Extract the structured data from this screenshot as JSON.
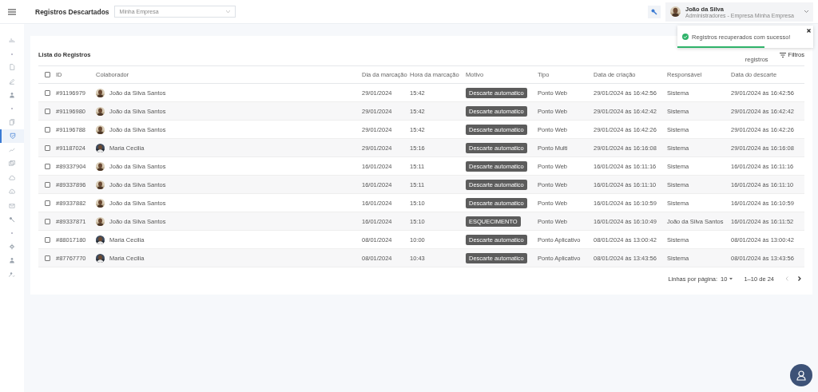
{
  "header": {
    "title": "Registros Descartados",
    "company_select": {
      "value": "Minha Empresa"
    },
    "user": {
      "name": "João da Silva",
      "role": "Administradores - Empresa Minha Empresa"
    }
  },
  "sidebar": {
    "items": [
      {
        "kind": "link",
        "selected": false
      },
      {
        "kind": "dot"
      },
      {
        "kind": "link",
        "selected": false
      },
      {
        "kind": "link",
        "selected": false
      },
      {
        "kind": "link",
        "selected": false
      },
      {
        "kind": "dot"
      },
      {
        "kind": "link",
        "selected": false
      },
      {
        "kind": "link",
        "selected": true
      },
      {
        "kind": "link",
        "selected": false
      },
      {
        "kind": "link",
        "selected": false
      },
      {
        "kind": "link",
        "selected": false
      },
      {
        "kind": "link",
        "selected": false
      },
      {
        "kind": "link",
        "selected": false
      },
      {
        "kind": "link",
        "selected": false
      },
      {
        "kind": "dot"
      },
      {
        "kind": "link",
        "selected": false
      },
      {
        "kind": "link",
        "selected": false
      },
      {
        "kind": "link",
        "selected": false
      }
    ]
  },
  "toast": {
    "message": "Registros recuperados com sucesso!",
    "level": 0.64
  },
  "card": {
    "title": "Lista do Registros",
    "recover_label": "registros",
    "filter_button": "Filtros"
  },
  "table": {
    "all_checked": false,
    "columns": [
      "ID",
      "Colaborador",
      "Dia da marcação",
      "Hora da marcação",
      "Motivo",
      "Tipo",
      "Data de criação",
      "Responsável",
      "Data do descarte"
    ],
    "rows": [
      {
        "checked": false,
        "id": "#91196979",
        "colaborador": "João da Silva Santos",
        "dia": "29/01/2024",
        "hora": "15:42",
        "motivo": "Descarte automatico",
        "tipo": "Ponto Web",
        "criacao": "29/01/2024 às 16:42:56",
        "responsavel": "Sistema",
        "descarte": "29/01/2024 às 16:42:56"
      },
      {
        "checked": false,
        "id": "#91196980",
        "colaborador": "João da Silva Santos",
        "dia": "29/01/2024",
        "hora": "15:42",
        "motivo": "Descarte automatico",
        "tipo": "Ponto Web",
        "criacao": "29/01/2024 às 16:42:42",
        "responsavel": "Sistema",
        "descarte": "29/01/2024 às 16:42:42"
      },
      {
        "checked": false,
        "id": "#91196788",
        "colaborador": "João da Silva Santos",
        "dia": "29/01/2024",
        "hora": "15:42",
        "motivo": "Descarte automatico",
        "tipo": "Ponto Web",
        "criacao": "29/01/2024 às 16:42:26",
        "responsavel": "Sistema",
        "descarte": "29/01/2024 às 16:42:26"
      },
      {
        "checked": false,
        "id": "#91187024",
        "colaborador": "Maria Cecilia",
        "dia": "29/01/2024",
        "hora": "15:16",
        "motivo": "Descarte automatico",
        "tipo": "Ponto Multi",
        "criacao": "29/01/2024 às 16:16:08",
        "responsavel": "Sistema",
        "descarte": "29/01/2024 às 16:16:08"
      },
      {
        "checked": false,
        "id": "#89337904",
        "colaborador": "João da Silva Santos",
        "dia": "16/01/2024",
        "hora": "15:11",
        "motivo": "Descarte automatico",
        "tipo": "Ponto Web",
        "criacao": "16/01/2024 às 16:11:16",
        "responsavel": "Sistema",
        "descarte": "16/01/2024 às 16:11:16"
      },
      {
        "checked": false,
        "id": "#89337896",
        "colaborador": "João da Silva Santos",
        "dia": "16/01/2024",
        "hora": "15:11",
        "motivo": "Descarte automatico",
        "tipo": "Ponto Web",
        "criacao": "16/01/2024 às 16:11:10",
        "responsavel": "Sistema",
        "descarte": "16/01/2024 às 16:11:10"
      },
      {
        "checked": false,
        "id": "#89337882",
        "colaborador": "João da Silva Santos",
        "dia": "16/01/2024",
        "hora": "15:10",
        "motivo": "Descarte automatico",
        "tipo": "Ponto Web",
        "criacao": "16/01/2024 às 16:10:59",
        "responsavel": "Sistema",
        "descarte": "16/01/2024 às 16:10:59"
      },
      {
        "checked": false,
        "id": "#89337871",
        "colaborador": "João da Silva Santos",
        "dia": "16/01/2024",
        "hora": "15:10",
        "motivo": "ESQUECIMENTO",
        "tipo": "Ponto Web",
        "criacao": "16/01/2024 às 16:10:49",
        "responsavel": "João da Silva Santos",
        "descarte": "16/01/2024 às 16:11:52"
      },
      {
        "checked": false,
        "id": "#88017180",
        "colaborador": "Maria Cecilia",
        "dia": "08/01/2024",
        "hora": "10:00",
        "motivo": "Descarte automatico",
        "tipo": "Ponto Aplicativo",
        "criacao": "08/01/2024 às 13:00:42",
        "responsavel": "Sistema",
        "descarte": "08/01/2024 às 13:00:42"
      },
      {
        "checked": false,
        "id": "#87767770",
        "colaborador": "Maria Cecilia",
        "dia": "08/01/2024",
        "hora": "10:43",
        "motivo": "Descarte automatico",
        "tipo": "Ponto Aplicativo",
        "criacao": "08/01/2024 às 13:43:56",
        "responsavel": "Sistema",
        "descarte": "08/01/2024 às 13:43:56"
      }
    ]
  },
  "pagination": {
    "rows_label": "Linhas por página:",
    "rows_value": "10",
    "range": "1–10 de 24",
    "prev_disabled": true,
    "next_disabled": false
  }
}
